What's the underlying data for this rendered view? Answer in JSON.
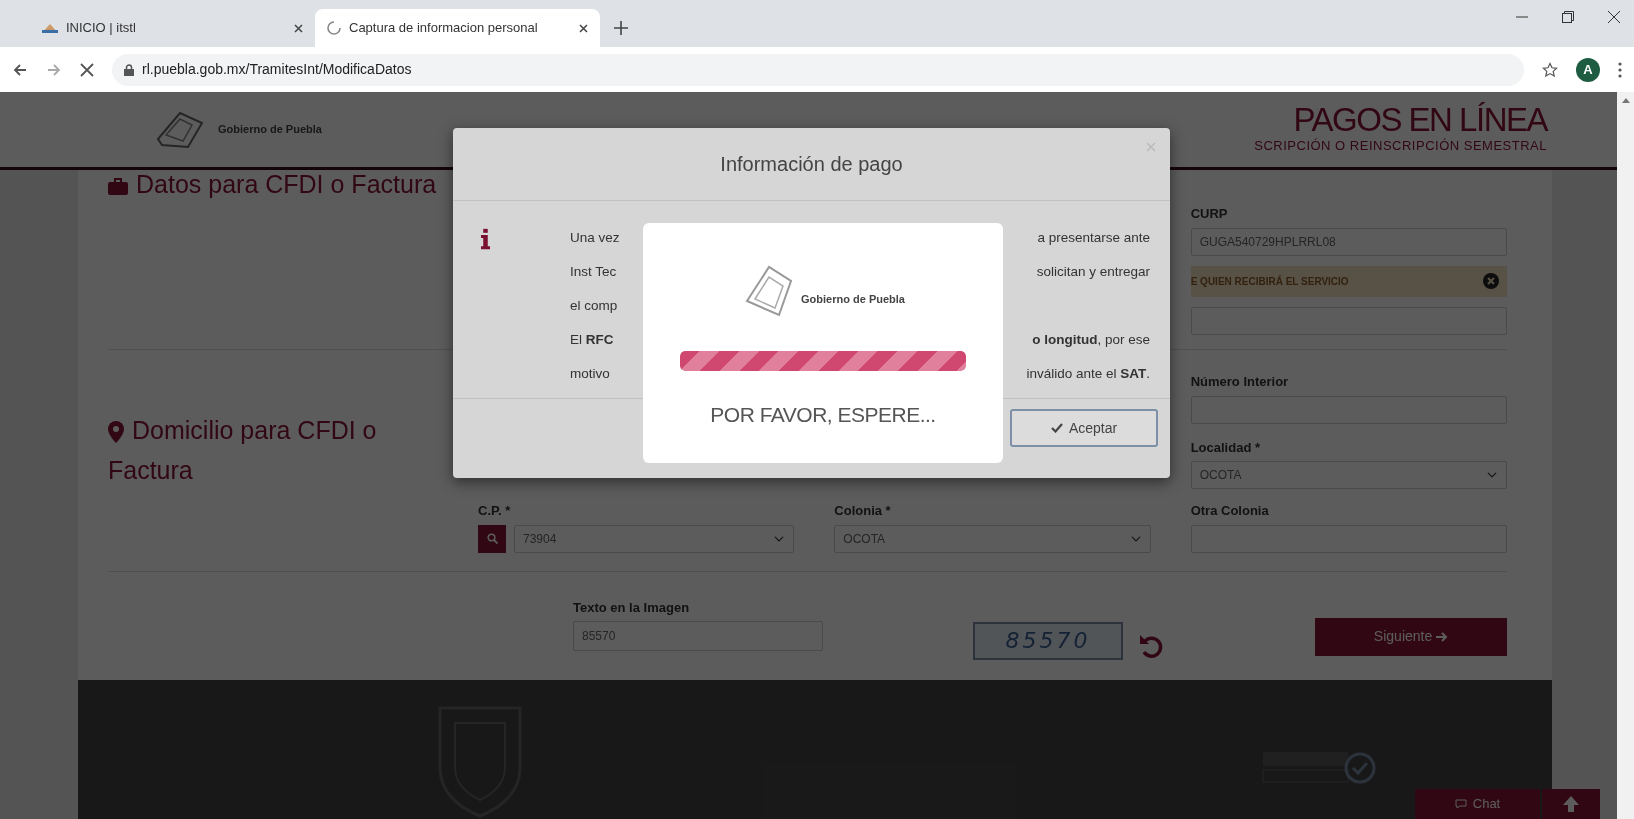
{
  "browser": {
    "tabs": [
      {
        "label": "INICIO | itstl",
        "selected": false,
        "loading": false
      },
      {
        "label": "Captura de informacion personal",
        "selected": true,
        "loading": true
      }
    ],
    "url": "rl.puebla.gob.mx/TramitesInt/ModificaDatos",
    "profile_initial": "A"
  },
  "header": {
    "logo_text": "Gobierno de Puebla",
    "title": "PAGOS EN LÍNEA",
    "subtitle": "SCRIPCIÓN O REINSCRIPCIÓN SEMESTRAL"
  },
  "sections": [
    {
      "kind": "billing",
      "title": "Datos para CFDI o Factura"
    },
    {
      "kind": "address",
      "title": "Domicilio para CFDI o Factura"
    }
  ],
  "billing_fields": {
    "curp_label": "CURP",
    "curp_value": "GUGA540729HPLRRL08",
    "alert": "E QUIEN RECIBIRÁ EL SERVICIO"
  },
  "address_fields": [
    {
      "label": "Número Interior",
      "kind": "input"
    },
    {
      "label": "Localidad *",
      "kind": "select",
      "value": "OCOTA"
    }
  ],
  "address_row": [
    {
      "label": "C.P. *",
      "kind": "search-select",
      "value": "73904"
    },
    {
      "label": "Colonia *",
      "kind": "select",
      "value": "OCOTA"
    },
    {
      "label": "Otra Colonia",
      "kind": "input"
    }
  ],
  "captcha": {
    "label": "Texto en la Imagen",
    "value": "85570",
    "image_text": "85570"
  },
  "next_button": "Siguiente",
  "chat_button": "Chat",
  "modal": {
    "title": "Información de pago",
    "text_lines": [
      {
        "left": "Una vez",
        "right": "a presentarse ante"
      },
      {
        "left": "Inst Tec",
        "right": "solicitan y entregar"
      },
      {
        "left": "el comp"
      },
      {
        "left": "El **RFC**",
        "right": "**o longitud**, por ese"
      },
      {
        "left": "motivo",
        "right": "inválido ante el **SAT**."
      }
    ],
    "buttons": [
      {
        "label": "Aceptar",
        "kind": "accept"
      }
    ]
  },
  "loader": {
    "logo_text": "Gobierno de Puebla",
    "level": 1,
    "message": "POR FAVOR, ESPERE..."
  }
}
